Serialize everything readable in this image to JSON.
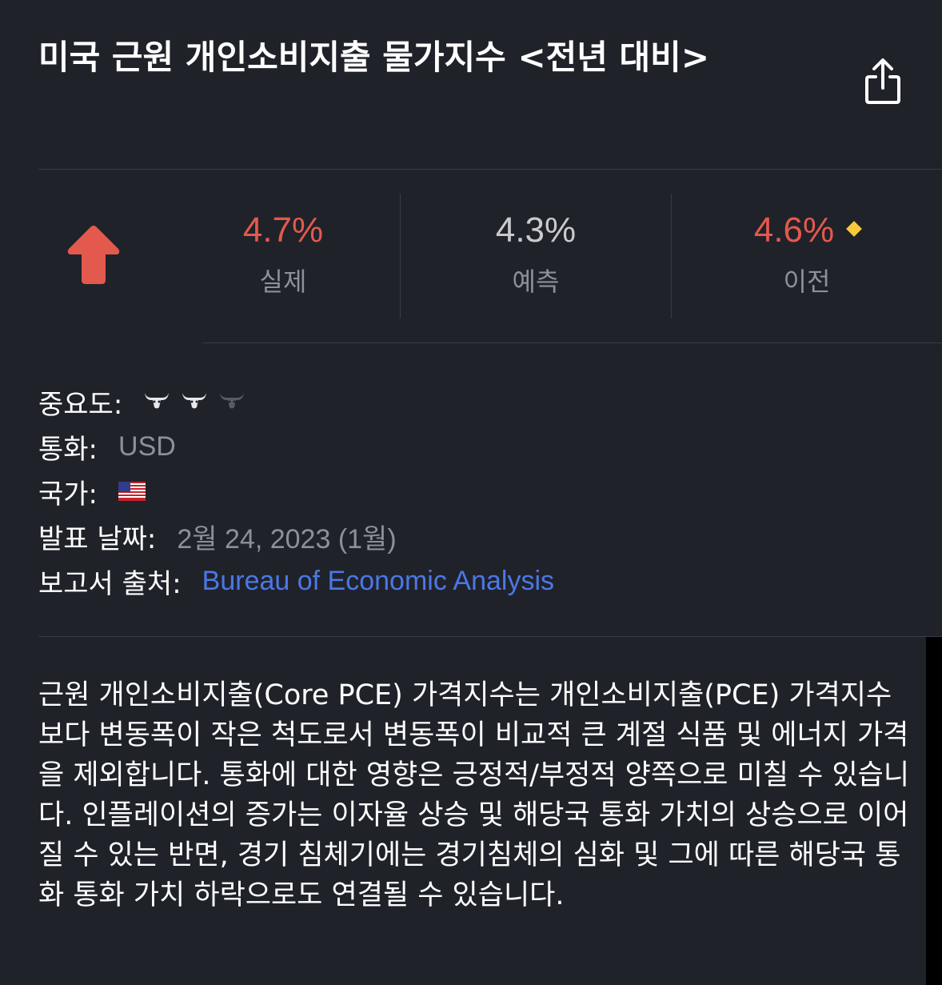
{
  "header": {
    "title": "미국 근원 개인소비지출 물가지수 <전년 대비>",
    "share_icon": "share-icon"
  },
  "stats": {
    "direction_icon": "arrow-up-icon",
    "actual": {
      "value": "4.7%",
      "label": "실제",
      "color": "#e4594d"
    },
    "forecast": {
      "value": "4.3%",
      "label": "예측",
      "color": "#c9cacf"
    },
    "previous": {
      "value": "4.6%",
      "label": "이전",
      "color": "#e4594d",
      "revised_icon": "diamond-icon",
      "revised_color": "#f7c93d"
    }
  },
  "details": {
    "importance": {
      "label": "중요도:",
      "level": 2,
      "max": 3,
      "icon": "bull-icon"
    },
    "currency": {
      "label": "통화:",
      "value": "USD"
    },
    "country": {
      "label": "국가:",
      "icon": "us-flag-icon"
    },
    "release_date": {
      "label": "발표 날짜:",
      "value": "2월 24, 2023 (1월)"
    },
    "source": {
      "label": "보고서 출처:",
      "value": "Bureau of Economic Analysis",
      "color": "#4b78e6"
    }
  },
  "description": "근원 개인소비지출(Core PCE) 가격지수는 개인소비지출(PCE) 가격지수보다 변동폭이 작은 척도로서 변동폭이 비교적 큰 계절 식품 및 에너지 가격을 제외합니다. 통화에 대한 영향은 긍정적/부정적 양쪽으로 미칠 수 있습니다. 인플레이션의 증가는 이자율 상승 및 해당국 통화 가치의 상승으로 이어질 수 있는 반면, 경기 침체기에는 경기침체의 심화 및 그에 따른 해당국 통화 통화 가치 하락으로도 연결될 수 있습니다."
}
